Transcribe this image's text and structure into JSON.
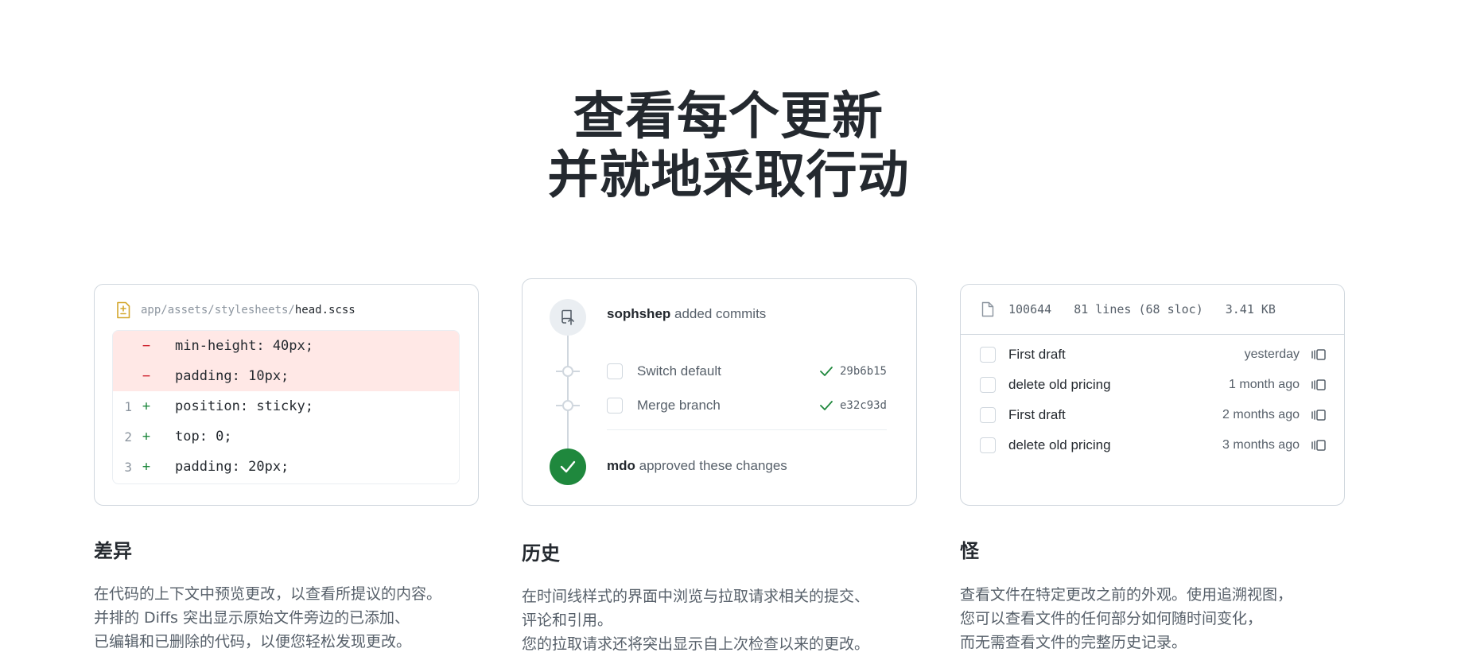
{
  "hero": {
    "line1": "查看每个更新",
    "line2": "并就地采取行动"
  },
  "diff_card": {
    "path_prefix": "app/assets/stylesheets/",
    "file_name": "head.scss",
    "lines": [
      {
        "type": "removed",
        "num": "",
        "sign": "−",
        "code": "min-height: 40px;"
      },
      {
        "type": "removed",
        "num": "",
        "sign": "−",
        "code": "padding: 10px;"
      },
      {
        "type": "added",
        "num": "1",
        "sign": "+",
        "code": "position: sticky;"
      },
      {
        "type": "added",
        "num": "2",
        "sign": "+",
        "code": "top: 0;"
      },
      {
        "type": "added",
        "num": "3",
        "sign": "+",
        "code": "padding: 20px;"
      }
    ]
  },
  "history_card": {
    "header_user": "sophshep",
    "header_action": " added commits",
    "commits": [
      {
        "label": "Switch default",
        "sha": "29b6b15"
      },
      {
        "label": "Merge branch",
        "sha": "e32c93d"
      }
    ],
    "approve_user": "mdo",
    "approve_action": " approved these changes"
  },
  "blame_card": {
    "mode": "100644",
    "lines": "81 lines (68 sloc)",
    "size": "3.41 KB",
    "rows": [
      {
        "label": "First draft",
        "time": "yesterday"
      },
      {
        "label": "delete old pricing",
        "time": "1 month ago"
      },
      {
        "label": "First draft",
        "time": "2 months ago"
      },
      {
        "label": "delete old pricing",
        "time": "3 months ago"
      }
    ]
  },
  "features": {
    "diff": {
      "title": "差异",
      "desc": [
        "在代码的上下文中预览更改，以查看所提议的内容。",
        "并排的 Diffs 突出显示原始文件旁边的已添加、",
        "已编辑和已删除的代码，以便您轻松发现更改。"
      ]
    },
    "history": {
      "title": "历史",
      "desc": [
        "在时间线样式的界面中浏览与拉取请求相关的提交、",
        "评论和引用。",
        "您的拉取请求还将突出显示自上次检查以来的更改。"
      ]
    },
    "blame": {
      "title": "怪",
      "desc": [
        "查看文件在特定更改之前的外观。使用追溯视图，",
        "您可以查看文件的任何部分如何随时间变化，",
        "而无需查看文件的完整历史记录。"
      ]
    }
  },
  "colors": {
    "removed_bg": "#ffe8e6",
    "removed_sign": "#cf222e",
    "added_sign": "#1f883d",
    "approve_green": "#1f883d",
    "file_icon": "#d4a72c"
  }
}
